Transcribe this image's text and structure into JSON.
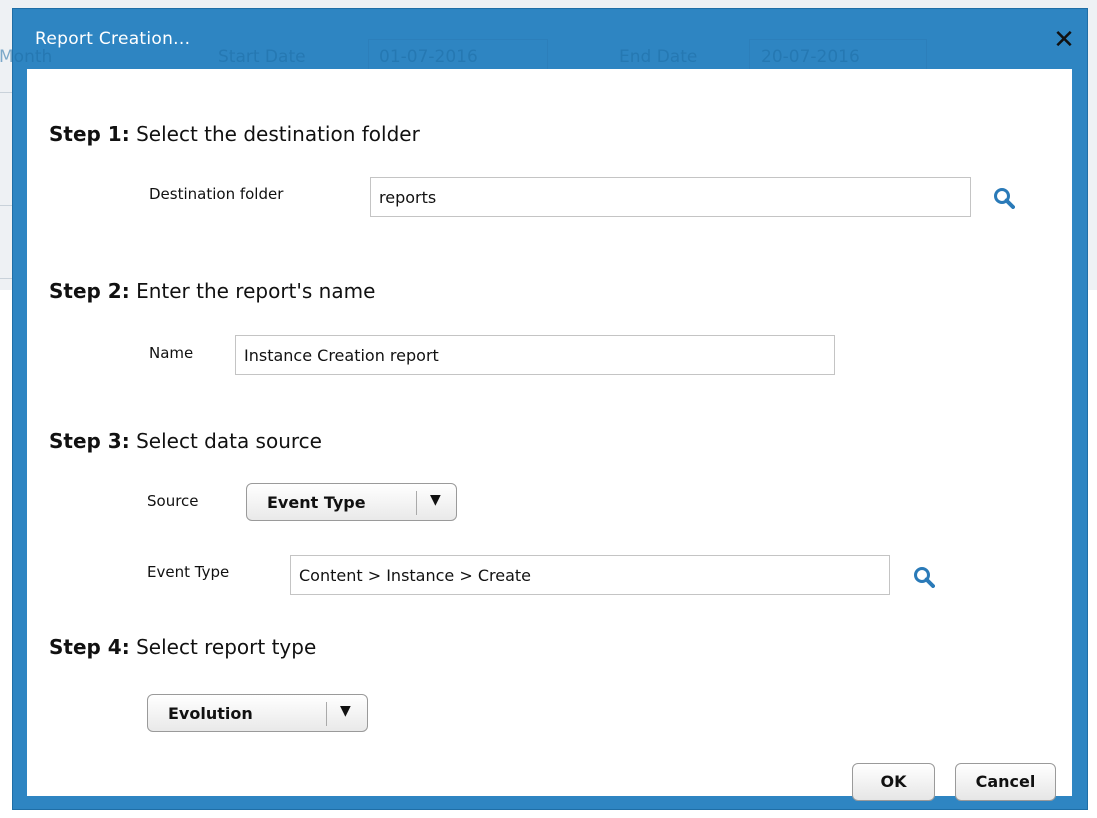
{
  "dialog": {
    "title": "Report Creation...",
    "close_symbol": "✕"
  },
  "background": {
    "month_text": "Month",
    "start_date_label": "Start Date",
    "start_date_value": "01-07-2016",
    "end_date_label": "End Date",
    "end_date_value": "20-07-2016"
  },
  "step1": {
    "prefix": "Step 1:",
    "text": " Select the destination folder",
    "field_label": "Destination folder",
    "field_value": "reports",
    "icon": "search-icon"
  },
  "step2": {
    "prefix": "Step 2:",
    "text": " Enter the report's name",
    "field_label": "Name",
    "field_value": "Instance Creation report"
  },
  "step3": {
    "prefix": "Step 3:",
    "text": " Select data source",
    "source_label": "Source",
    "source_value": "Event Type",
    "event_label": "Event Type",
    "event_value": "Content > Instance > Create",
    "icon": "search-icon"
  },
  "step4": {
    "prefix": "Step 4:",
    "text": " Select report type",
    "type_value": "Evolution"
  },
  "buttons": {
    "ok": "OK",
    "cancel": "Cancel"
  },
  "colors": {
    "dialog_frame": "#2e85c2",
    "icon_blue": "#2a7ab8"
  }
}
